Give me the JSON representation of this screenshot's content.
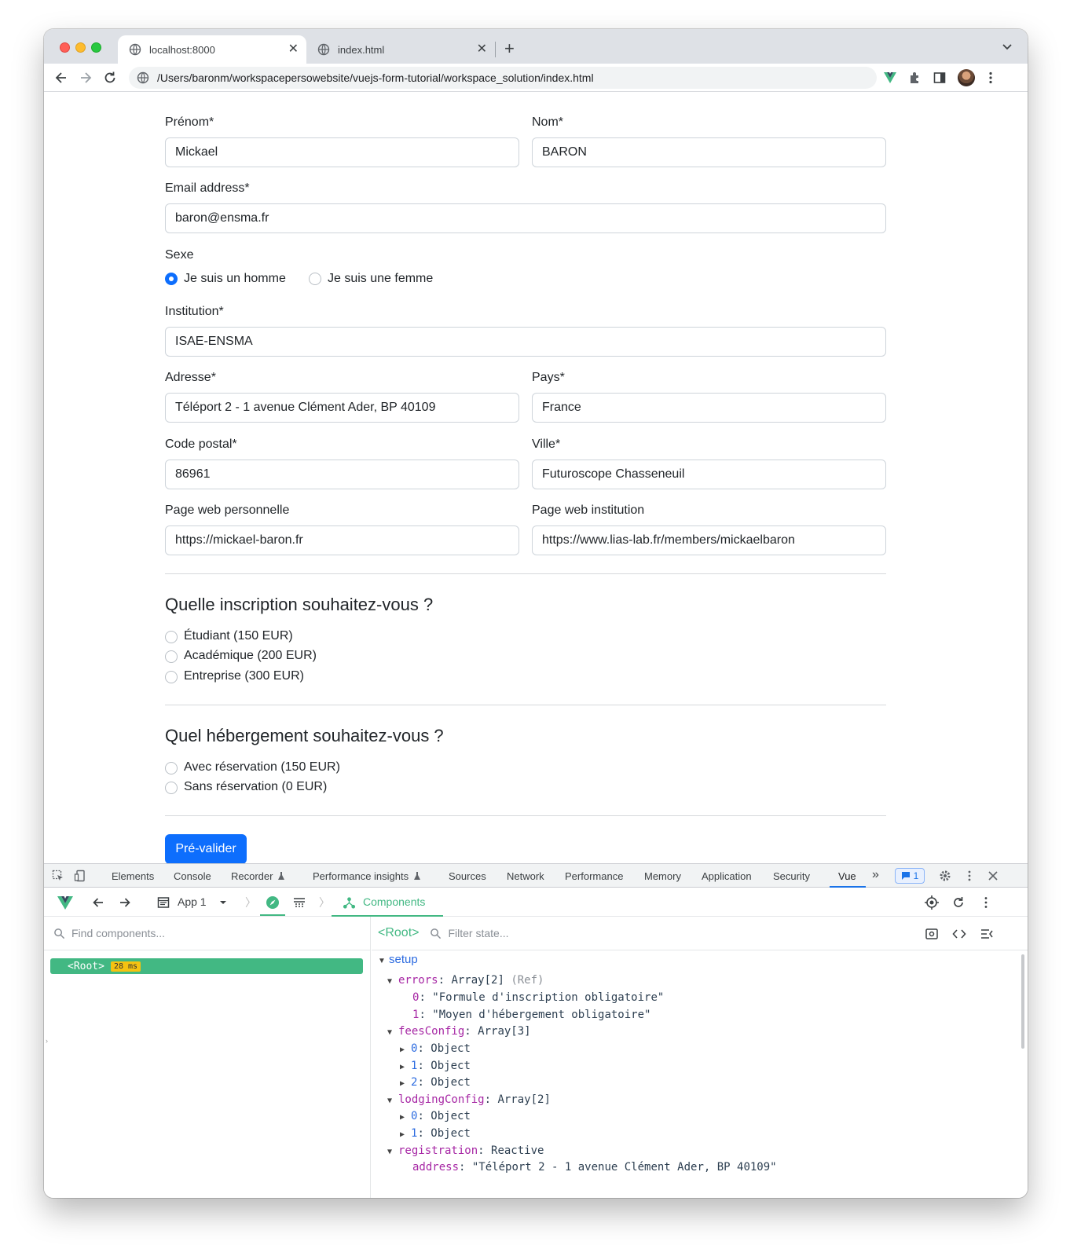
{
  "browser": {
    "tabs": [
      {
        "title": "localhost:8000",
        "active": true
      },
      {
        "title": "index.html",
        "active": false
      }
    ],
    "url": "/Users/baronm/workspacepersowebsite/vuejs-form-tutorial/workspace_solution/index.html"
  },
  "form": {
    "prenom": {
      "label": "Prénom*",
      "value": "Mickael"
    },
    "nom": {
      "label": "Nom*",
      "value": "BARON"
    },
    "email": {
      "label": "Email address*",
      "value": "baron@ensma.fr"
    },
    "sexe": {
      "label": "Sexe",
      "options": [
        {
          "label": "Je suis un homme",
          "checked": true
        },
        {
          "label": "Je suis une femme",
          "checked": false
        }
      ]
    },
    "institution": {
      "label": "Institution*",
      "value": "ISAE-ENSMA"
    },
    "adresse": {
      "label": "Adresse*",
      "value": "Téléport 2 - 1 avenue Clément Ader, BP 40109"
    },
    "pays": {
      "label": "Pays*",
      "value": "France"
    },
    "code_postal": {
      "label": "Code postal*",
      "value": "86961"
    },
    "ville": {
      "label": "Ville*",
      "value": "Futuroscope Chasseneuil"
    },
    "page_perso": {
      "label": "Page web personnelle",
      "value": "https://mickael-baron.fr"
    },
    "page_inst": {
      "label": "Page web institution",
      "value": "https://www.lias-lab.fr/members/mickaelbaron"
    },
    "inscription": {
      "title": "Quelle inscription souhaitez-vous ?",
      "options": [
        "Étudiant (150 EUR)",
        "Académique (200 EUR)",
        "Entreprise (300 EUR)"
      ]
    },
    "hebergement": {
      "title": "Quel hébergement souhaitez-vous ?",
      "options": [
        "Avec réservation (150 EUR)",
        "Sans réservation (0 EUR)"
      ]
    },
    "submit_label": "Pré-valider"
  },
  "devtools": {
    "tabs": [
      "Elements",
      "Console",
      "Recorder",
      "Performance insights",
      "Sources",
      "Network",
      "Performance",
      "Memory",
      "Application",
      "Security",
      "Vue"
    ],
    "active_tab": "Vue",
    "issues_count": "1",
    "vue": {
      "app_label": "App 1",
      "components_label": "Components",
      "find_placeholder": "Find components...",
      "root_label": "<Root>",
      "root_time": "28 ms",
      "filter_placeholder": "Filter state...",
      "section": "setup",
      "state": {
        "errors_key": "errors",
        "errors_type": "Array[2]",
        "errors_ref": "(Ref)",
        "errors_0": "\"Formule d'inscription obligatoire\"",
        "errors_1": "\"Moyen d'hébergement obligatoire\"",
        "fees_key": "feesConfig",
        "fees_type": "Array[3]",
        "lodging_key": "lodgingConfig",
        "lodging_type": "Array[2]",
        "object_label": "Object",
        "registration_key": "registration",
        "registration_type": "Reactive",
        "address_key": "address",
        "address_value": "\"Téléport 2 - 1 avenue Clément Ader, BP 40109\""
      }
    }
  }
}
